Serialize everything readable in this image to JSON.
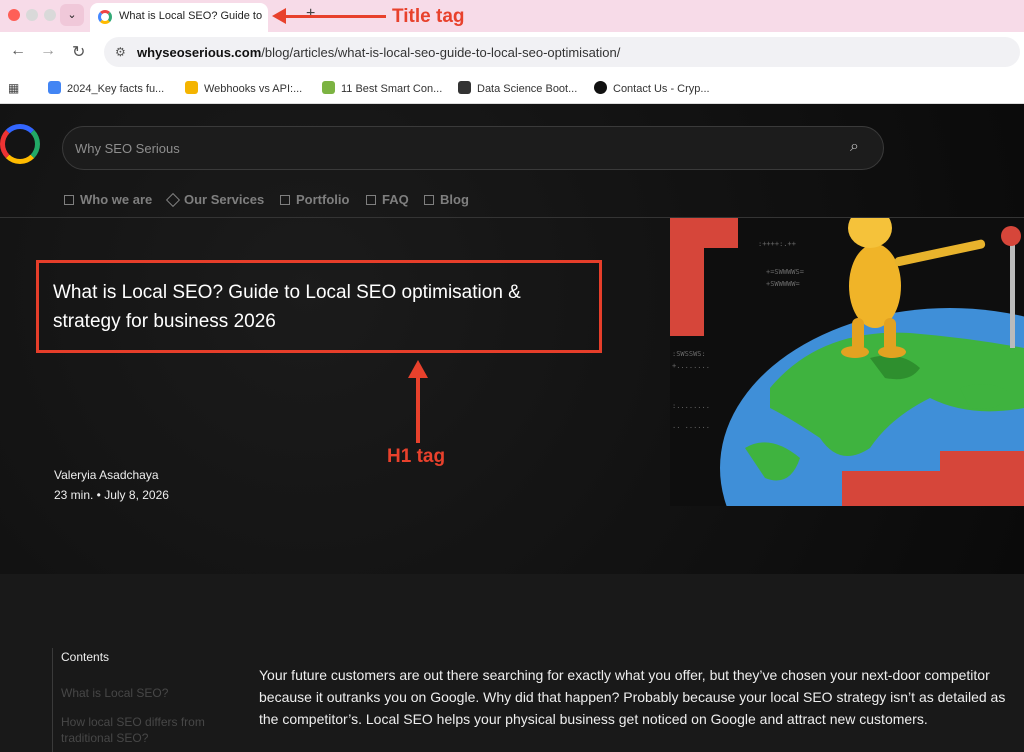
{
  "browser": {
    "tab_title": "What is Local SEO? Guide to Local SEO",
    "new_tab": "+",
    "menu_chevron": "⌄",
    "back_icon": "←",
    "forward_icon": "→",
    "reload_icon": "↻",
    "url_domain": "whyseoserious.com",
    "url_path": "/blog/articles/what-is-local-seo-guide-to-local-seo-optimisation/",
    "bookmarks": [
      {
        "label": "2024_Key facts fu...",
        "color": "#4285f4"
      },
      {
        "label": "Webhooks vs API:...",
        "color": "#f4b400"
      },
      {
        "label": "11 Best Smart Con...",
        "color": "#7cb342"
      },
      {
        "label": "Data Science Boot...",
        "color": "#333333"
      },
      {
        "label": "Contact Us - Cryp...",
        "color": "#111111"
      }
    ]
  },
  "annotations": {
    "title_tag": "Title tag",
    "h1_tag": "H1 tag",
    "color": "#e8412c"
  },
  "site": {
    "search_placeholder": "Why SEO Serious",
    "nav": [
      "Who we are",
      "Our Services",
      "Portfolio",
      "FAQ",
      "Blog"
    ]
  },
  "article": {
    "h1": "What is Local SEO? Guide to Local SEO optimisation & strategy for business 2026",
    "author": "Valeryia Asadchaya",
    "meta": "23 min. • July 8, 2026",
    "contents_title": "Contents",
    "toc": [
      "What is Local SEO?",
      "How local SEO differs from traditional SEO?"
    ],
    "intro": "Your future customers are out there searching for exactly what you offer, but they’ve chosen your next-door competitor because it outranks you on Google. Why did that happen? Probably because your local SEO strategy isn’t as detailed as the competitor’s. Local SEO helps your physical business get noticed on Google and attract new customers."
  }
}
